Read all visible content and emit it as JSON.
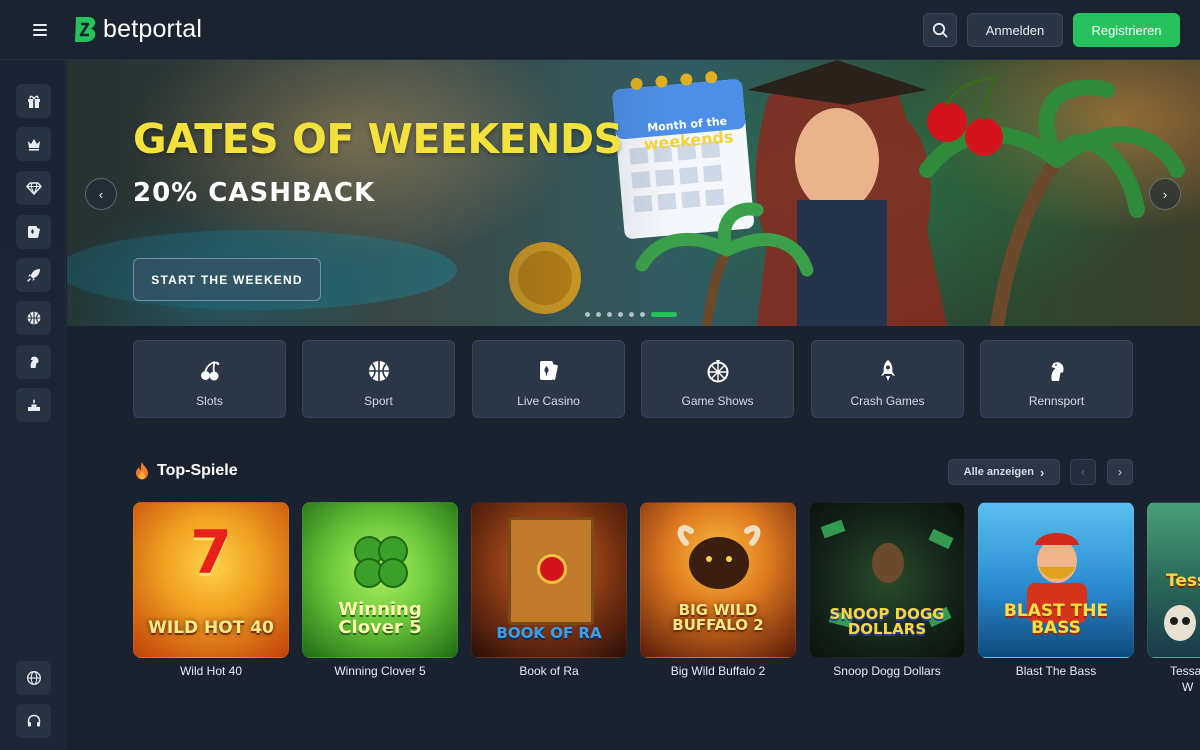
{
  "header": {
    "brand": "betportal",
    "login_label": "Anmelden",
    "register_label": "Registrieren"
  },
  "sidebar": {
    "items": [
      {
        "icon": "gift-icon"
      },
      {
        "icon": "crown-icon"
      },
      {
        "icon": "diamond-icon"
      },
      {
        "icon": "live-casino-icon"
      },
      {
        "icon": "rocket-icon"
      },
      {
        "icon": "basketball-icon"
      },
      {
        "icon": "horse-icon"
      },
      {
        "icon": "podium-icon"
      }
    ],
    "bottom": [
      {
        "icon": "globe-icon"
      },
      {
        "icon": "headset-icon"
      }
    ]
  },
  "banner": {
    "title": "GATES OF WEEKENDS",
    "subtitle": "20% CASHBACK",
    "cta": "START THE WEEKEND",
    "calendar_line1": "Month of the",
    "calendar_line2": "weekends",
    "slide_count": 7,
    "active_slide": 7
  },
  "categories": [
    {
      "label": "Slots",
      "icon": "cherries-icon"
    },
    {
      "label": "Sport",
      "icon": "basketball-icon"
    },
    {
      "label": "Live Casino",
      "icon": "playing-card-icon"
    },
    {
      "label": "Game Shows",
      "icon": "wheel-icon"
    },
    {
      "label": "Crash Games",
      "icon": "rocket-icon"
    },
    {
      "label": "Rennsport",
      "icon": "horse-icon"
    }
  ],
  "top_games": {
    "title": "Top-Spiele",
    "see_all": "Alle anzeigen",
    "games": [
      {
        "name": "Wild Hot 40",
        "art": "WILD HOT 40",
        "colors": [
          "#f0a020",
          "#c0400a"
        ]
      },
      {
        "name": "Winning Clover 5",
        "art": "Winning Clover 5",
        "colors": [
          "#7ed24a",
          "#2a8a1e"
        ]
      },
      {
        "name": "Book of Ra",
        "art": "BOOK OF RA",
        "colors": [
          "#b04a1a",
          "#3a1a0e"
        ]
      },
      {
        "name": "Big Wild Buffalo 2",
        "art": "BIG WILD BUFFALO 2",
        "colors": [
          "#e07a20",
          "#5a1a0a"
        ]
      },
      {
        "name": "Snoop Dogg Dollars",
        "art": "SNOOP DOGG DOLLARS",
        "colors": [
          "#2a3a2a",
          "#0e1a12"
        ]
      },
      {
        "name": "Blast The Bass",
        "art": "BLAST THE BASS",
        "colors": [
          "#3aa0d8",
          "#0e4a7a"
        ]
      },
      {
        "name": "Tessa",
        "art": "Tess",
        "colors": [
          "#4aa07a",
          "#1a3a4a"
        ]
      }
    ],
    "partial_caption_line2": "W"
  },
  "colors": {
    "accent_green": "#25c25e",
    "banner_title": "#f4e23c",
    "background": "#1a2230"
  }
}
